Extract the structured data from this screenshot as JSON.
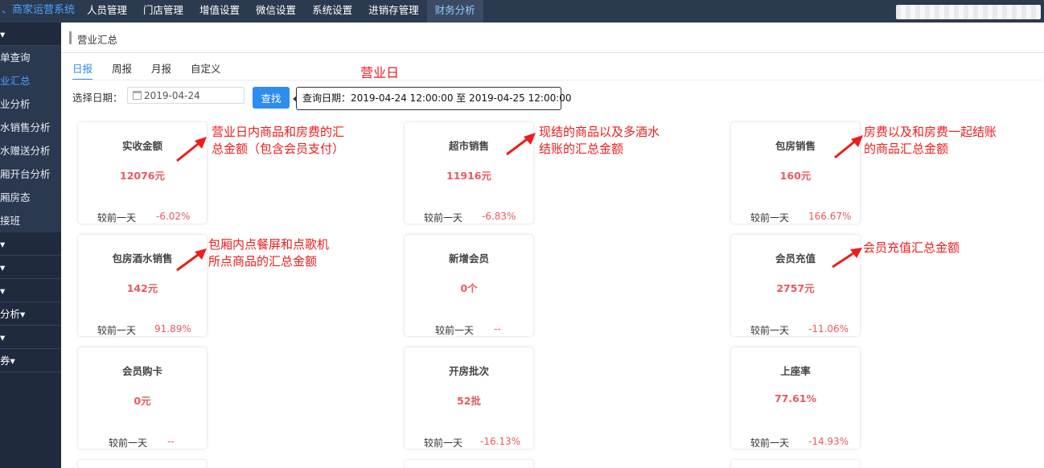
{
  "topbar": {
    "brand": "、商家运营系统",
    "nav": [
      {
        "label": "人员管理",
        "active": false
      },
      {
        "label": "门店管理",
        "active": false
      },
      {
        "label": "增值设置",
        "active": false
      },
      {
        "label": "微信设置",
        "active": false
      },
      {
        "label": "系统设置",
        "active": false
      },
      {
        "label": "进销存管理",
        "active": false
      },
      {
        "label": "财务分析",
        "active": true
      }
    ]
  },
  "sidebar": {
    "rows": [
      {
        "label": "▾",
        "type": "group"
      },
      {
        "label": "单查询",
        "type": "sub"
      },
      {
        "label": "业汇总",
        "type": "sub",
        "active": true
      },
      {
        "label": "业分析",
        "type": "sub"
      },
      {
        "label": "水销售分析",
        "type": "sub"
      },
      {
        "label": "水赠送分析",
        "type": "sub"
      },
      {
        "label": "厢开台分析",
        "type": "sub"
      },
      {
        "label": "厢房态",
        "type": "sub"
      },
      {
        "label": "接班",
        "type": "sub"
      },
      {
        "label": "▾",
        "type": "group"
      },
      {
        "label": "▾",
        "type": "group"
      },
      {
        "label": "▾",
        "type": "group"
      },
      {
        "label": "分析▾",
        "type": "group"
      },
      {
        "label": "▾",
        "type": "group"
      },
      {
        "label": "券▾",
        "type": "group"
      }
    ]
  },
  "breadcrumb": "营业汇总",
  "tabs": [
    {
      "label": "日报",
      "active": true
    },
    {
      "label": "周报",
      "active": false
    },
    {
      "label": "月报",
      "active": false
    },
    {
      "label": "自定义",
      "active": false
    }
  ],
  "filter": {
    "date_label": "选择日期：",
    "date_value": "2019-04-24",
    "search_label": "查找",
    "query_tip": "查询日期：2019-04-24 12:00:00 至 2019-04-25 12:00:00"
  },
  "cards": [
    {
      "title": "实收金额",
      "value": "12076元",
      "compare_label": "较前一天",
      "compare_value": "-6.02%"
    },
    {
      "title": "超市销售",
      "value": "11916元",
      "compare_label": "较前一天",
      "compare_value": "-6.83%"
    },
    {
      "title": "包房销售",
      "value": "160元",
      "compare_label": "较前一天",
      "compare_value": "166.67%"
    },
    {
      "title": "包房酒水销售",
      "value": "142元",
      "compare_label": "较前一天",
      "compare_value": "91.89%"
    },
    {
      "title": "新增会员",
      "value": "0个",
      "compare_label": "较前一天",
      "compare_value": "--"
    },
    {
      "title": "会员充值",
      "value": "2757元",
      "compare_label": "较前一天",
      "compare_value": "-11.06%"
    },
    {
      "title": "会员购卡",
      "value": "0元",
      "compare_label": "较前一天",
      "compare_value": "--"
    },
    {
      "title": "开房批次",
      "value": "52批",
      "compare_label": "较前一天",
      "compare_value": "-16.13%"
    },
    {
      "title": "上座率",
      "value": "77.61%",
      "compare_label": "较前一天",
      "compare_value": "-14.93%"
    }
  ],
  "annotations": {
    "business_day": "营业日",
    "note1": [
      "营业日内商品和房费的汇",
      "总金额（包含会员支付）"
    ],
    "note2": [
      "现结的商品以及多酒水",
      "结账的汇总金额"
    ],
    "note3": [
      "房费以及和房费一起结账",
      "的商品汇总金额"
    ],
    "note4": [
      "包厢内点餐屏和点歌机",
      "所点商品的汇总金额"
    ],
    "note5": "会员充值汇总金额"
  },
  "colors": {
    "accent": "#2d8cf0",
    "value_red": "#e8595f",
    "annotation_red": "#ee1c1c",
    "topbar": "#2c3a4f",
    "sidebar": "#1f2a3c"
  }
}
